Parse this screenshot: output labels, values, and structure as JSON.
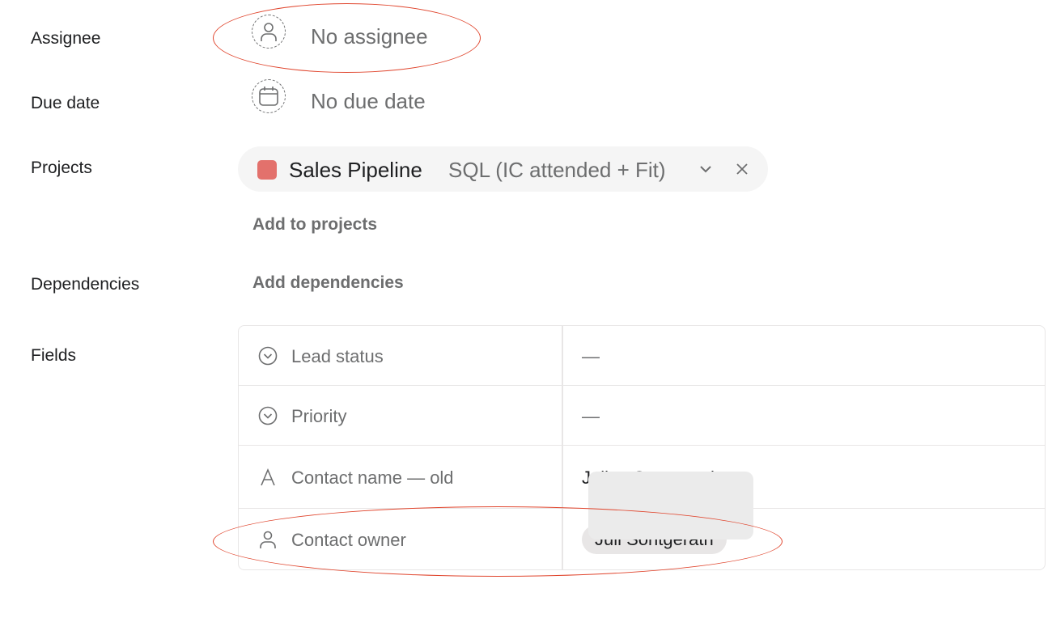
{
  "assignee": {
    "label": "Assignee",
    "value": "No assignee"
  },
  "due_date": {
    "label": "Due date",
    "value": "No due date"
  },
  "projects": {
    "label": "Projects",
    "project_name": "Sales Pipeline",
    "section": "SQL (IC attended + Fit)",
    "color": "#e3716c",
    "add_label": "Add to projects"
  },
  "dependencies": {
    "label": "Dependencies",
    "add_label": "Add dependencies"
  },
  "fields": {
    "label": "Fields",
    "rows": [
      {
        "name": "Lead status",
        "value": "—",
        "icon": "chevron-circle-icon"
      },
      {
        "name": "Priority",
        "value": "—",
        "icon": "chevron-circle-icon"
      },
      {
        "name": "Contact name — old",
        "value": "Julian Sontgerath",
        "icon": "text-icon"
      },
      {
        "name": "Contact owner",
        "value": "Juli Sontgerath",
        "icon": "person-icon"
      }
    ]
  },
  "annotation_color": "#e0452d"
}
